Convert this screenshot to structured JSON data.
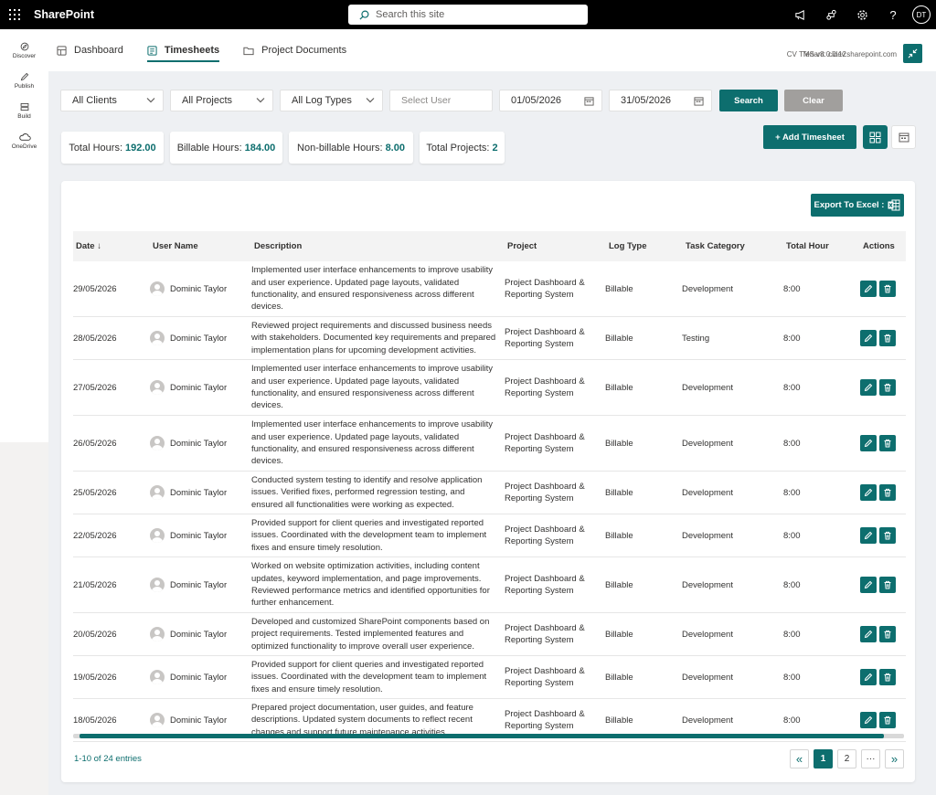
{
  "app": {
    "brand": "SharePoint",
    "search_placeholder": "Search this site",
    "user_initials": "DT"
  },
  "rail": [
    {
      "label": "Discover",
      "icon": "discover-icon"
    },
    {
      "label": "Publish",
      "icon": "publish-icon"
    },
    {
      "label": "Build",
      "icon": "build-icon"
    },
    {
      "label": "OneDrive",
      "icon": "onedrive-icon"
    }
  ],
  "tabs": [
    {
      "label": "Dashboard",
      "icon": "dashboard-icon",
      "active": false
    },
    {
      "label": "Timesheets",
      "icon": "timesheets-icon",
      "active": true
    },
    {
      "label": "Project Documents",
      "icon": "folder-icon",
      "active": false
    }
  ],
  "header": {
    "version": "CV TMS v8.0.0.12",
    "tenant": "Tenant: cidev.sharepoint.com"
  },
  "filters": {
    "clients": "All Clients",
    "projects": "All Projects",
    "log_types": "All Log Types",
    "user_placeholder": "Select User",
    "from_date": "01/05/2026",
    "to_date": "31/05/2026",
    "search_label": "Search",
    "clear_label": "Clear"
  },
  "stats": [
    {
      "label": "Total Hours:",
      "value": "192.00"
    },
    {
      "label": "Billable Hours:",
      "value": "184.00"
    },
    {
      "label": "Non-billable Hours:",
      "value": "8.00"
    },
    {
      "label": "Total Projects:",
      "value": "2"
    }
  ],
  "actions": {
    "add_label": "+ Add Timesheet",
    "export_label": "Export To Excel :"
  },
  "table": {
    "headers": [
      "Date ↓",
      "User Name",
      "Description",
      "Project",
      "Log Type",
      "Task Category",
      "Total Hour",
      "Actions"
    ],
    "rows": [
      {
        "date": "29/05/2026",
        "user": "Dominic Taylor",
        "desc": "Implemented user interface enhancements to improve usability and user experience. Updated page layouts, validated functionality, and ensured responsiveness across different devices.",
        "project": "Project Dashboard & Reporting System",
        "log": "Billable",
        "category": "Development",
        "hours": "8:00"
      },
      {
        "date": "28/05/2026",
        "user": "Dominic Taylor",
        "desc": "Reviewed project requirements and discussed business needs with stakeholders. Documented key requirements and prepared implementation plans for upcoming development activities.",
        "project": "Project Dashboard & Reporting System",
        "log": "Billable",
        "category": "Testing",
        "hours": "8:00"
      },
      {
        "date": "27/05/2026",
        "user": "Dominic Taylor",
        "desc": "Implemented user interface enhancements to improve usability and user experience. Updated page layouts, validated functionality, and ensured responsiveness across different devices.",
        "project": "Project Dashboard & Reporting System",
        "log": "Billable",
        "category": "Development",
        "hours": "8:00"
      },
      {
        "date": "26/05/2026",
        "user": "Dominic Taylor",
        "desc": "Implemented user interface enhancements to improve usability and user experience. Updated page layouts, validated functionality, and ensured responsiveness across different devices.",
        "project": "Project Dashboard & Reporting System",
        "log": "Billable",
        "category": "Development",
        "hours": "8:00"
      },
      {
        "date": "25/05/2026",
        "user": "Dominic Taylor",
        "desc": "Conducted system testing to identify and resolve application issues. Verified fixes, performed regression testing, and ensured all functionalities were working as expected.",
        "project": "Project Dashboard & Reporting System",
        "log": "Billable",
        "category": "Development",
        "hours": "8:00"
      },
      {
        "date": "22/05/2026",
        "user": "Dominic Taylor",
        "desc": "Provided support for client queries and investigated reported issues. Coordinated with the development team to implement fixes and ensure timely resolution.",
        "project": "Project Dashboard & Reporting System",
        "log": "Billable",
        "category": "Development",
        "hours": "8:00"
      },
      {
        "date": "21/05/2026",
        "user": "Dominic Taylor",
        "desc": "Worked on website optimization activities, including content updates, keyword implementation, and page improvements. Reviewed performance metrics and identified opportunities for further enhancement.",
        "project": "Project Dashboard & Reporting System",
        "log": "Billable",
        "category": "Development",
        "hours": "8:00"
      },
      {
        "date": "20/05/2026",
        "user": "Dominic Taylor",
        "desc": "Developed and customized SharePoint components based on project requirements. Tested implemented features and optimized functionality to improve overall user experience.",
        "project": "Project Dashboard & Reporting System",
        "log": "Billable",
        "category": "Development",
        "hours": "8:00"
      },
      {
        "date": "19/05/2026",
        "user": "Dominic Taylor",
        "desc": "Provided support for client queries and investigated reported issues. Coordinated with the development team to implement fixes and ensure timely resolution.",
        "project": "Project Dashboard & Reporting System",
        "log": "Billable",
        "category": "Development",
        "hours": "8:00"
      },
      {
        "date": "18/05/2026",
        "user": "Dominic Taylor",
        "desc": "Prepared project documentation, user guides, and feature descriptions. Updated system documents to reflect recent changes and support future maintenance activities.",
        "project": "Project Dashboard & Reporting System",
        "log": "Billable",
        "category": "Development",
        "hours": "8:00"
      }
    ]
  },
  "footer": {
    "entries": "1-10 of 24 entries",
    "pages": [
      "«",
      "1",
      "2",
      "···",
      "»"
    ],
    "active_page": "1"
  },
  "colors": {
    "accent": "#0d6e6e",
    "topbar": "#000000",
    "clear_button": "#a19f9d"
  }
}
